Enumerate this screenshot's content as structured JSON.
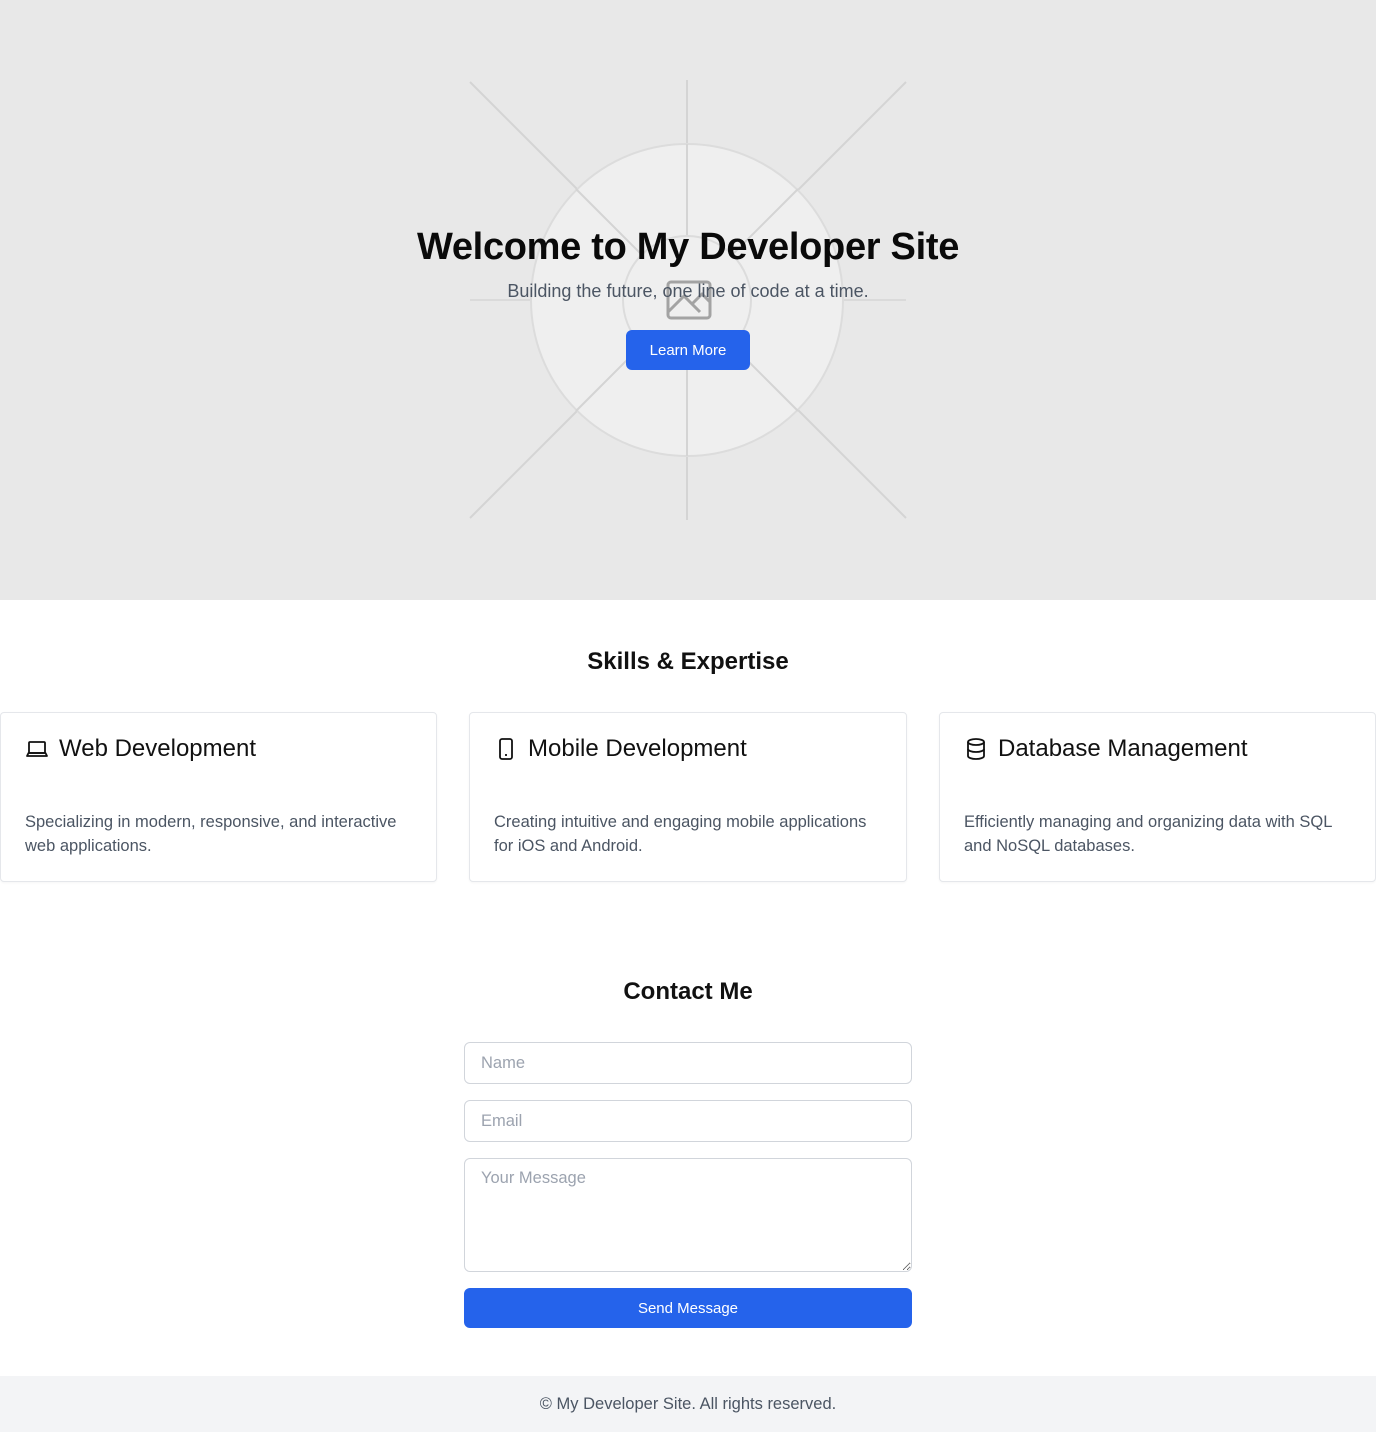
{
  "hero": {
    "title": "Welcome to My Developer Site",
    "subtitle": "Building the future, one line of code at a time.",
    "button_label": "Learn More",
    "background_color": "#e8e8e8",
    "placeholder_icon": "image-placeholder-icon"
  },
  "skills": {
    "heading": "Skills & Expertise",
    "items": [
      {
        "icon": "laptop-icon",
        "title": "Web Development",
        "description": "Specializing in modern, responsive, and interactive web applications."
      },
      {
        "icon": "mobile-icon",
        "title": "Mobile Development",
        "description": "Creating intuitive and engaging mobile applications for iOS and Android."
      },
      {
        "icon": "database-icon",
        "title": "Database Management",
        "description": "Efficiently managing and organizing data with SQL and NoSQL databases."
      }
    ]
  },
  "contact": {
    "heading": "Contact Me",
    "name_placeholder": "Name",
    "email_placeholder": "Email",
    "message_placeholder": "Your Message",
    "submit_label": "Send Message"
  },
  "footer": {
    "text": "© My Developer Site. All rights reserved."
  },
  "colors": {
    "accent": "#2563eb",
    "footer_bg": "#f3f4f6",
    "muted_text": "#4b5563"
  }
}
